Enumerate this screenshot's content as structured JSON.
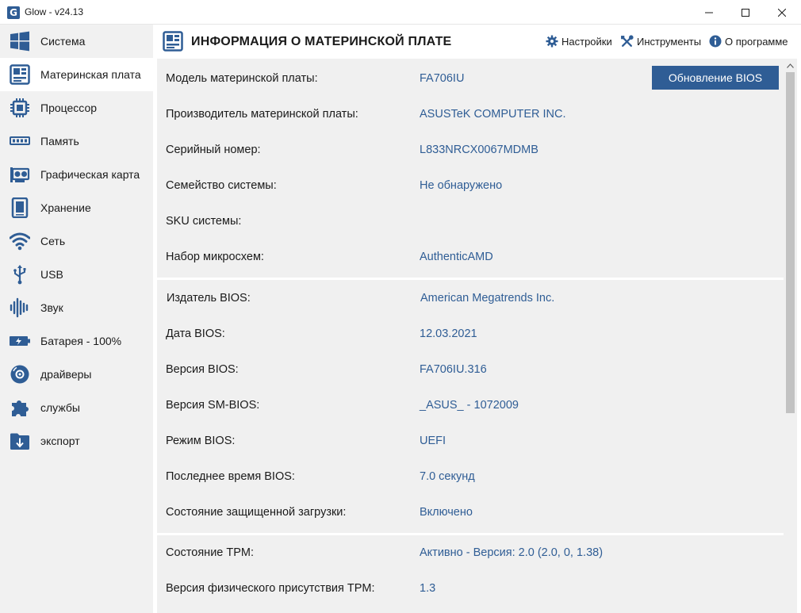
{
  "window": {
    "logo_letter": "G",
    "title": "Glow - v24.13"
  },
  "sidebar": {
    "items": [
      {
        "label": "Система",
        "icon": "windows-icon"
      },
      {
        "label": "Материнская плата",
        "icon": "motherboard-icon",
        "active": true
      },
      {
        "label": "Процессор",
        "icon": "cpu-icon"
      },
      {
        "label": "Память",
        "icon": "memory-icon"
      },
      {
        "label": "Графическая карта",
        "icon": "gpu-icon"
      },
      {
        "label": "Хранение",
        "icon": "storage-icon"
      },
      {
        "label": "Сеть",
        "icon": "wifi-icon"
      },
      {
        "label": "USB",
        "icon": "usb-icon"
      },
      {
        "label": "Звук",
        "icon": "sound-icon"
      },
      {
        "label": "Батарея - 100%",
        "icon": "battery-icon"
      },
      {
        "label": "драйверы",
        "icon": "driver-disc-icon"
      },
      {
        "label": "службы",
        "icon": "puzzle-icon"
      },
      {
        "label": "экспорт",
        "icon": "export-icon"
      }
    ]
  },
  "header": {
    "title": "ИНФОРМАЦИЯ О МАТЕРИНСКОЙ ПЛАТЕ",
    "settings_label": "Настройки",
    "tools_label": "Инструменты",
    "about_label": "О программе"
  },
  "bios_update_button": "Обновление BIOS",
  "sections": [
    {
      "rows": [
        {
          "label": "Модель материнской платы:",
          "value": "FA706IU"
        },
        {
          "label": "Производитель материнской платы:",
          "value": "ASUSTeK COMPUTER INC."
        },
        {
          "label": "Серийный номер:",
          "value": "L833NRCX0067MDMB"
        },
        {
          "label": "Семейство системы:",
          "value": "Не обнаружено"
        },
        {
          "label": "SKU системы:",
          "value": ""
        },
        {
          "label": "Набор микросхем:",
          "value": "AuthenticAMD"
        }
      ]
    },
    {
      "rows": [
        {
          "label": "Издатель BIOS:",
          "value": "American Megatrends Inc."
        },
        {
          "label": "Дата BIOS:",
          "value": "12.03.2021"
        },
        {
          "label": "Версия BIOS:",
          "value": "FA706IU.316"
        },
        {
          "label": "Версия SM-BIOS:",
          "value": "_ASUS_ - 1072009"
        },
        {
          "label": "Режим BIOS:",
          "value": "UEFI"
        },
        {
          "label": "Последнее время BIOS:",
          "value": "7.0 секунд"
        },
        {
          "label": "Состояние защищенной загрузки:",
          "value": "Включено"
        }
      ]
    },
    {
      "rows": [
        {
          "label": "Состояние TPM:",
          "value": "Активно - Версия: 2.0 (2.0, 0, 1.38)"
        },
        {
          "label": "Версия физического присутствия TPM:",
          "value": "1.3"
        }
      ]
    }
  ],
  "colors": {
    "accent": "#2f5d95",
    "sidebar_bg": "#f1f1f1",
    "content_bg": "#f0f0f0"
  }
}
